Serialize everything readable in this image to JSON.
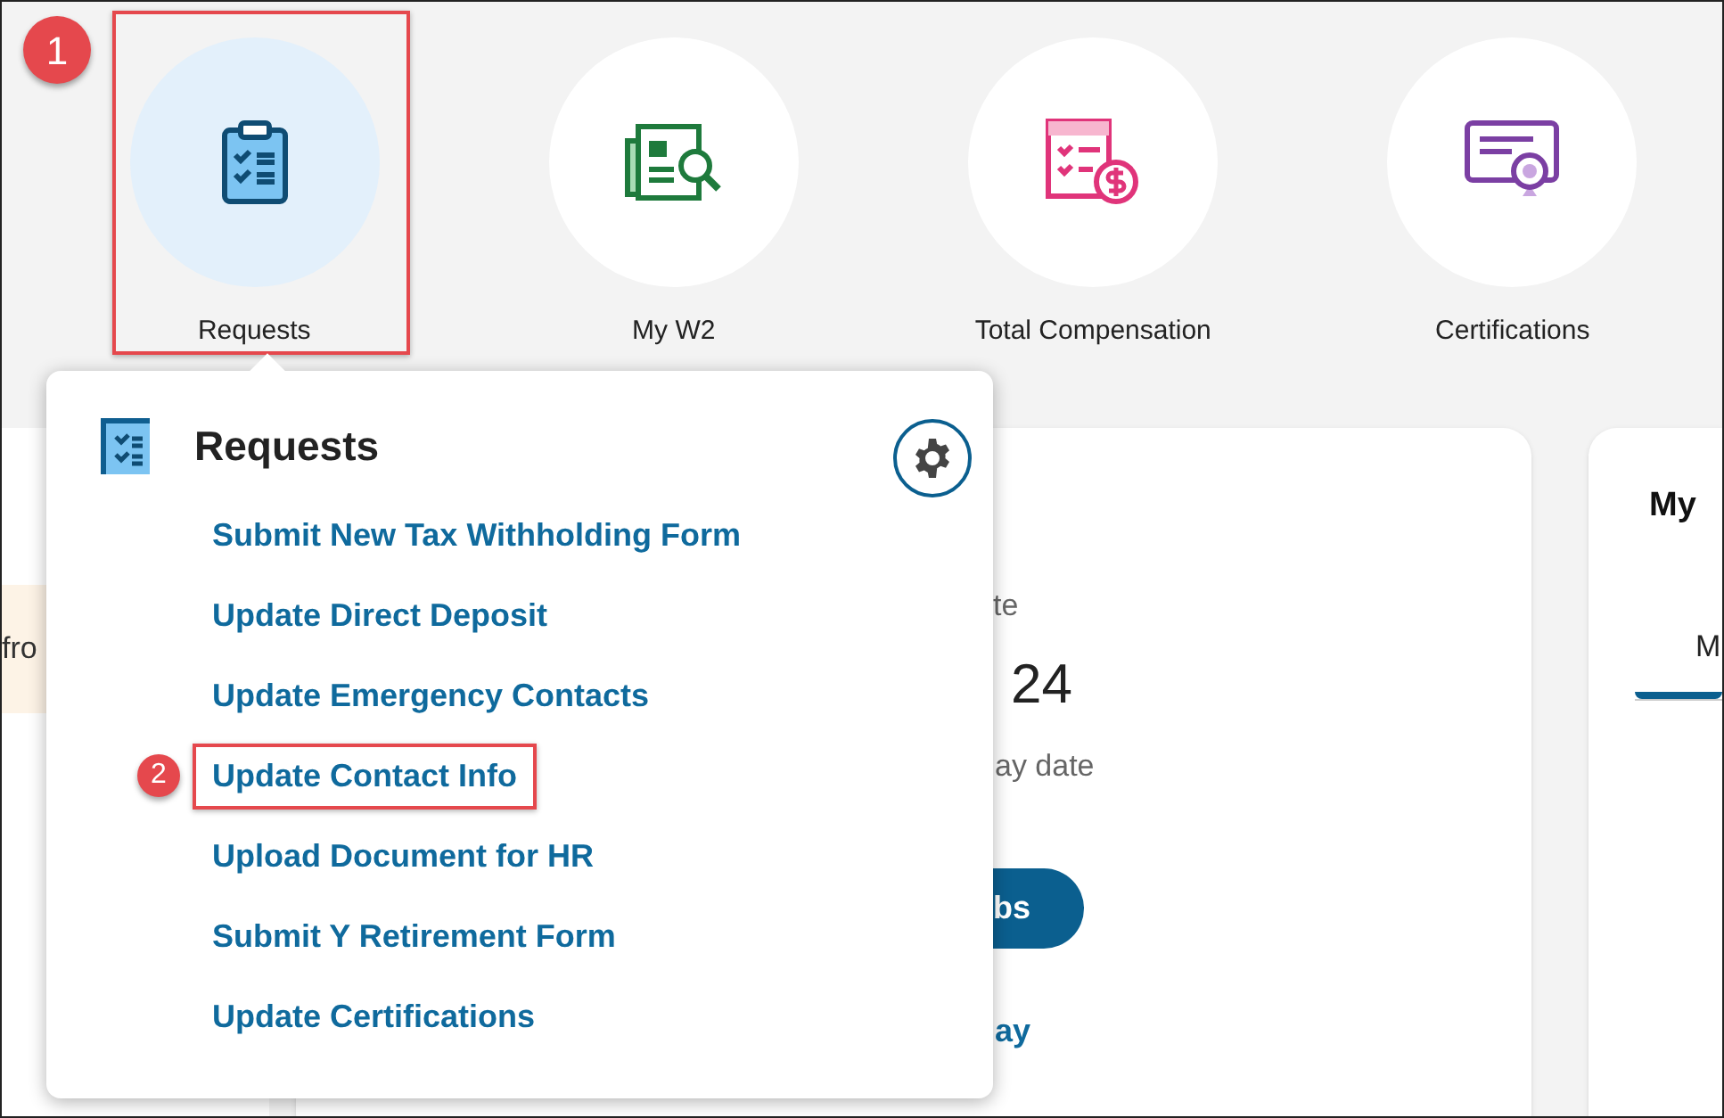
{
  "tiles": [
    {
      "label": "Requests",
      "selected": true,
      "highlighted": true,
      "callout": "1"
    },
    {
      "label": "My W2",
      "selected": false,
      "highlighted": false
    },
    {
      "label": "Total Compensation",
      "selected": false,
      "highlighted": false
    },
    {
      "label": "Certifications",
      "selected": false,
      "highlighted": false
    }
  ],
  "left_card": {
    "notice": "fro"
  },
  "pay_card": {
    "label": "te",
    "date": "24",
    "caption": "ay date",
    "button": "bs",
    "link": "ay"
  },
  "right_card": {
    "title": "My",
    "tab": "M"
  },
  "popup": {
    "title": "Requests",
    "items": [
      {
        "label": "Submit New Tax Withholding Form",
        "highlighted": false
      },
      {
        "label": "Update Direct Deposit",
        "highlighted": false
      },
      {
        "label": "Update Emergency Contacts",
        "highlighted": false
      },
      {
        "label": "Update Contact Info",
        "highlighted": true,
        "callout": "2"
      },
      {
        "label": "Upload Document for HR",
        "highlighted": false
      },
      {
        "label": "Submit Y Retirement Form",
        "highlighted": false
      },
      {
        "label": "Update Certifications",
        "highlighted": false
      }
    ]
  }
}
